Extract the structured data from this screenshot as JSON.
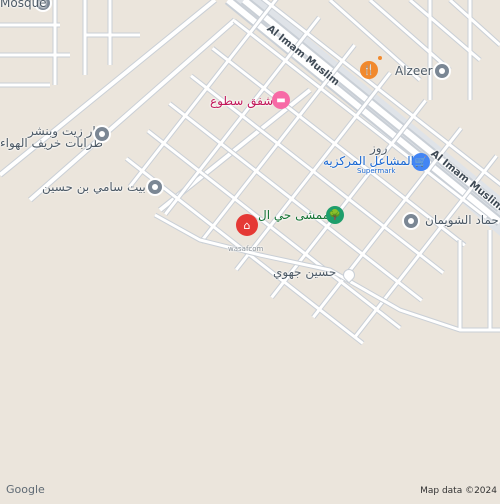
{
  "map": {
    "roads": [
      {
        "name": "Al Imam Muslim",
        "label_upper": "Al Imam Muslim",
        "label_lower": "Al Imam Muslim"
      }
    ],
    "pois": [
      {
        "id": "mosque",
        "name": "Mosque",
        "icon": "mosque-icon"
      },
      {
        "id": "alzeer",
        "name": "Alzeer",
        "icon": "place-pin-icon"
      },
      {
        "id": "shafaq",
        "name": "شفق سطوع",
        "icon": "lodging-icon"
      },
      {
        "id": "zayt",
        "name": "ار زيت وبنشر",
        "icon": "place-pin-icon"
      },
      {
        "id": "tarab",
        "name": "طرابات خريف الهواء",
        "icon": "place-pin-icon"
      },
      {
        "id": "mashael",
        "name": "المشاعل المركزيه",
        "icon": "shopping-cart-icon"
      },
      {
        "id": "supermarket",
        "name": "Supermark"
      },
      {
        "id": "rooz",
        "name": "روز"
      },
      {
        "id": "bait",
        "name": "بيت سامي بن حسين",
        "icon": "place-pin-icon"
      },
      {
        "id": "mamsha",
        "name": "ممشى حي ال",
        "icon": "park-icon"
      },
      {
        "id": "shwaiman",
        "name": "حماد الشويمان",
        "icon": "place-pin-icon"
      },
      {
        "id": "husain",
        "name": "حسين جهوي"
      },
      {
        "id": "home",
        "name": "wasafcom",
        "icon": "home-pin-icon"
      }
    ],
    "attribution": "Map data ©2024",
    "watermark": "Google",
    "colors": {
      "background": "#ebe5dc",
      "road": "#ffffff",
      "road_outline": "#c9cfd6",
      "highway": "#d4d9df",
      "home_pin": "#e53935",
      "park_pin": "#1e9e6b",
      "shop_pin": "#4285f4",
      "food_pin": "#f1892d",
      "lodging_pin": "#f76aa6"
    }
  }
}
